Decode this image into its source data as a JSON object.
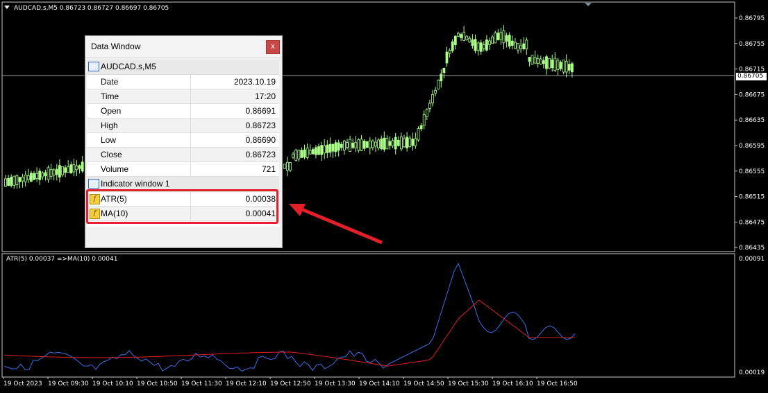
{
  "chart_header": {
    "symbol_label": "AUDCAD.s,M5",
    "ohlc_text": "0.86723 0.86727 0.86697 0.86705"
  },
  "price_axis": {
    "labels": [
      "0.86795",
      "0.86755",
      "0.86715",
      "0.86675",
      "0.86635",
      "0.86595",
      "0.86555",
      "0.86515",
      "0.86475",
      "0.86435"
    ],
    "current_price_tag": "0.86705"
  },
  "indicator_axis": {
    "top_label": "0.00091",
    "bottom_label": "0.00019"
  },
  "indicator_header": "ATR(5) 0.00037  =>MA(10) 0.00041",
  "time_axis": {
    "labels": [
      "19 Oct 2023",
      "19 Oct 09:30",
      "19 Oct 10:10",
      "19 Oct 10:50",
      "19 Oct 11:30",
      "19 Oct 12:10",
      "19 Oct 12:50",
      "19 Oct 13:30",
      "19 Oct 14:10",
      "19 Oct 14:50",
      "19 Oct 15:30",
      "19 Oct 16:10",
      "19 Oct 16:50"
    ]
  },
  "data_window": {
    "title": "Data Window",
    "close_label": "x",
    "symbol_header": "AUDCAD.s,M5",
    "rows": [
      {
        "key": "Date",
        "value": "2023.10.19"
      },
      {
        "key": "Time",
        "value": "17:20"
      },
      {
        "key": "Open",
        "value": "0.86691"
      },
      {
        "key": "High",
        "value": "0.86723"
      },
      {
        "key": "Low",
        "value": "0.86690"
      },
      {
        "key": "Close",
        "value": "0.86723"
      },
      {
        "key": "Volume",
        "value": "721"
      }
    ],
    "indicator_header": "Indicator window 1",
    "indicator_rows": [
      {
        "key": "ATR(5)",
        "value": "0.00038",
        "icon": "fx-custom-indicator-icon"
      },
      {
        "key": "MA(10)",
        "value": "0.00041",
        "icon": "fx-indicator-icon"
      }
    ]
  },
  "colors": {
    "background": "#000000",
    "bull_candle": "#aaff88",
    "atr_line": "#3a6fe8",
    "ma_line": "#e02020",
    "highlight": "#e3202a",
    "arrow": "#e3202a"
  }
}
